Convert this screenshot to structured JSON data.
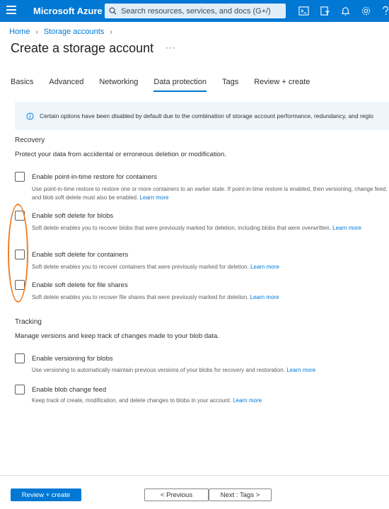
{
  "topbar": {
    "brand": "Microsoft Azure",
    "search_placeholder": "Search resources, services, and docs (G+/)",
    "accent": "#0078d4"
  },
  "breadcrumb": {
    "items": [
      "Home",
      "Storage accounts"
    ]
  },
  "page": {
    "title": "Create a storage account",
    "more": "···"
  },
  "tabs": [
    "Basics",
    "Advanced",
    "Networking",
    "Data protection",
    "Tags",
    "Review + create"
  ],
  "info": {
    "text": "Certain options have been disabled by default due to the combination of storage account performance, redundancy, and regio"
  },
  "recovery": {
    "title": "Recovery",
    "description": "Protect your data from accidental or erroneous deletion or modification.",
    "options": [
      {
        "label": "Enable point-in-time restore for containers",
        "desc": "Use point-in-time restore to restore one or more containers to an earlier state. If point-in-time restore is enabled, then versioning, change feed, and blob soft delete must also be enabled.",
        "link": "Learn more"
      },
      {
        "label": "Enable soft delete for blobs",
        "desc": "Soft delete enables you to recover blobs that were previously marked for deletion, including blobs that were overwritten.",
        "link": "Learn more"
      },
      {
        "label": "Enable soft delete for containers",
        "desc": "Soft delete enables you to recover containers that were previously marked for deletion.",
        "link": "Learn more"
      },
      {
        "label": "Enable soft delete for file shares",
        "desc": "Soft delete enables you to recover file shares that were previously marked for deletion.",
        "link": "Learn more"
      }
    ]
  },
  "tracking": {
    "title": "Tracking",
    "description": "Manage versions and keep track of changes made to your blob data.",
    "options": [
      {
        "label": "Enable versioning for blobs",
        "desc": "Use versioning to automatically maintain previous versions of your blobs for recovery and restoration.",
        "link": "Learn more"
      },
      {
        "label": "Enable blob change feed",
        "desc": "Keep track of create, modification, and delete changes to blobs in your account.",
        "link": "Learn more"
      }
    ]
  },
  "footer": {
    "review": "Review + create",
    "previous": "< Previous",
    "next": "Next : Tags >"
  }
}
